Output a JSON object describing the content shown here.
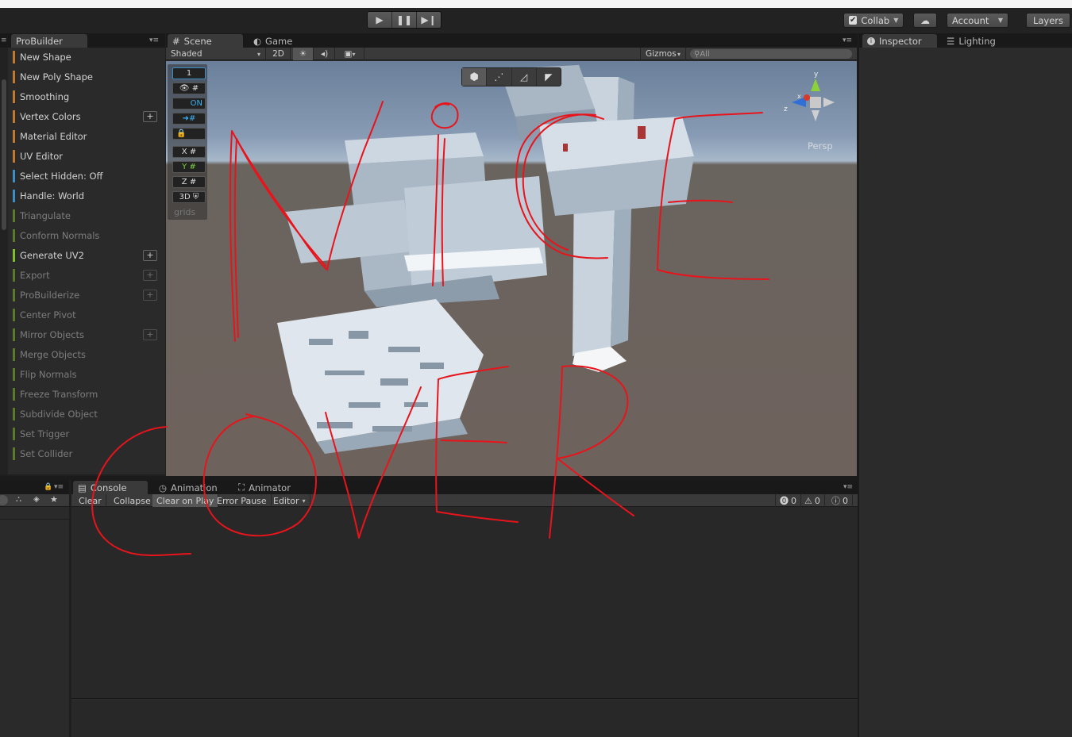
{
  "toolbar": {
    "collab_label": "Collab",
    "account_label": "Account",
    "layers_label": "Layers"
  },
  "probuilder": {
    "tab_label": "ProBuilder",
    "items": [
      {
        "label": "New Shape",
        "color": "#c07a30",
        "plus": false,
        "dim": false
      },
      {
        "label": "New Poly Shape",
        "color": "#c07a30",
        "plus": false,
        "dim": false
      },
      {
        "label": "Smoothing",
        "color": "#c07a30",
        "plus": false,
        "dim": false
      },
      {
        "label": "Vertex Colors",
        "color": "#c07a30",
        "plus": true,
        "dim": false
      },
      {
        "label": "Material Editor",
        "color": "#c07a30",
        "plus": false,
        "dim": false
      },
      {
        "label": "UV Editor",
        "color": "#c07a30",
        "plus": false,
        "dim": false
      },
      {
        "label": "Select Hidden: Off",
        "color": "#3b8fc4",
        "plus": false,
        "dim": false
      },
      {
        "label": "Handle: World",
        "color": "#3b8fc4",
        "plus": false,
        "dim": false
      },
      {
        "label": "Triangulate",
        "color": "#5a7a2a",
        "plus": false,
        "dim": true
      },
      {
        "label": "Conform Normals",
        "color": "#5a7a2a",
        "plus": false,
        "dim": true
      },
      {
        "label": "Generate UV2",
        "color": "#7fc02a",
        "plus": true,
        "dim": false
      },
      {
        "label": "Export",
        "color": "#5a7a2a",
        "plus": true,
        "dim": true
      },
      {
        "label": "ProBuilderize",
        "color": "#5a7a2a",
        "plus": true,
        "dim": true
      },
      {
        "label": "Center Pivot",
        "color": "#5a7a2a",
        "plus": false,
        "dim": true
      },
      {
        "label": "Mirror Objects",
        "color": "#5a7a2a",
        "plus": true,
        "dim": true
      },
      {
        "label": "Merge Objects",
        "color": "#5a7a2a",
        "plus": false,
        "dim": true
      },
      {
        "label": "Flip Normals",
        "color": "#5a7a2a",
        "plus": false,
        "dim": true
      },
      {
        "label": "Freeze Transform",
        "color": "#5a7a2a",
        "plus": false,
        "dim": true
      },
      {
        "label": "Subdivide Object",
        "color": "#5a7a2a",
        "plus": false,
        "dim": true
      },
      {
        "label": "Set Trigger",
        "color": "#5a7a2a",
        "plus": false,
        "dim": true
      },
      {
        "label": "Set Collider",
        "color": "#5a7a2a",
        "plus": false,
        "dim": true
      }
    ],
    "plus_symbol": "+"
  },
  "scene": {
    "tab_scene": "Scene",
    "tab_game": "Game",
    "shading_mode": "Shaded",
    "mode_2d": "2D",
    "gizmos_label": "Gizmos",
    "search_placeholder": "All",
    "persp_label": "Persp",
    "axis_y": "y",
    "axis_z": "z",
    "axis_x": "x",
    "grid": {
      "snap_value": "1",
      "on_label": "ON",
      "x_label": "X",
      "y_label": "Y",
      "z_label": "Z",
      "label_3d": "3D",
      "grids_label": "grids"
    }
  },
  "inspector": {
    "tab_inspector": "Inspector",
    "tab_lighting": "Lighting"
  },
  "console": {
    "tab_console": "Console",
    "tab_animation": "Animation",
    "tab_animator": "Animator",
    "clear": "Clear",
    "collapse": "Collapse",
    "clear_on_play": "Clear on Play",
    "error_pause": "Error Pause",
    "editor": "Editor",
    "count_errors": "0",
    "count_warnings": "0",
    "count_logs": "0"
  },
  "colors": {
    "accent_scribble": "#e8141c",
    "panel_bg": "#2a2a2a",
    "sky": "#889bb4",
    "ground": "#6e625c"
  }
}
